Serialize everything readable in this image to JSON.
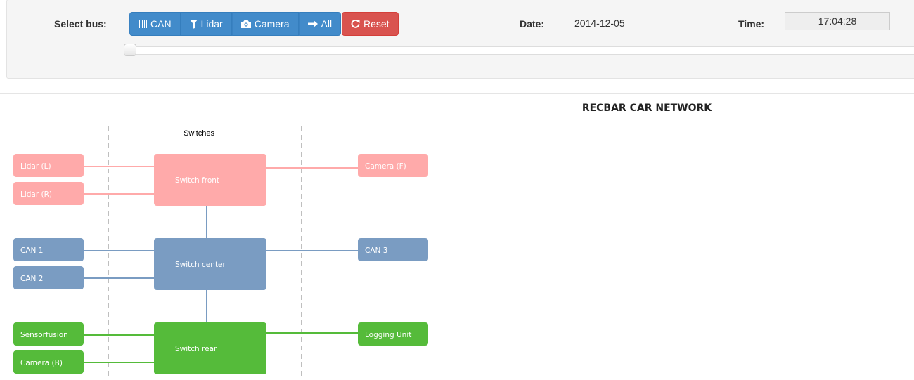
{
  "toolbar": {
    "select_bus_label": "Select bus:",
    "buttons": {
      "can": "CAN",
      "lidar": "Lidar",
      "camera": "Camera",
      "all": "All",
      "reset": "Reset"
    },
    "date_label": "Date:",
    "date_value": "2014-12-05",
    "time_label": "Time:",
    "time_value": "17:04:28",
    "slider_position": 0
  },
  "network": {
    "title": "RECBAR CAR NETWORK",
    "switches_label": "Switches",
    "colors": {
      "lidar_camera": "#ffaaaa",
      "can": "#7a9cc2",
      "other": "#55bb3a",
      "divider": "#aaaaaa"
    },
    "nodes": {
      "lidar_l": "Lidar (L)",
      "lidar_r": "Lidar (R)",
      "switch_front": "Switch front",
      "camera_f": "Camera (F)",
      "can1": "CAN 1",
      "can2": "CAN 2",
      "switch_center": "Switch center",
      "can3": "CAN 3",
      "sensorfusion": "Sensorfusion",
      "camera_b": "Camera (B)",
      "switch_rear": "Switch rear",
      "logging_unit": "Logging Unit"
    }
  }
}
